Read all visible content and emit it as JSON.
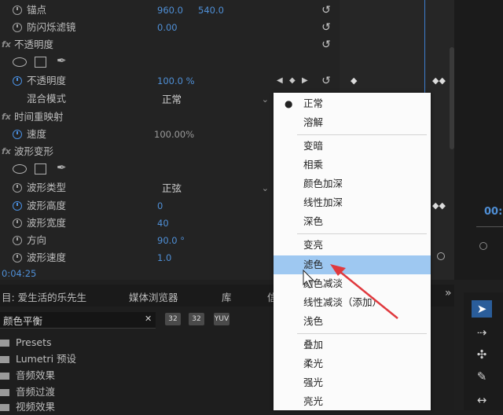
{
  "effect_controls": {
    "rows": [
      {
        "label": "锚点",
        "value": "960.0",
        "value2": "540.0"
      },
      {
        "label": "防闪烁滤镜",
        "value": "0.00"
      },
      {
        "label": "不透明度"
      },
      {
        "label": "不透明度",
        "value": "100.0 %"
      },
      {
        "label": "混合模式",
        "value": "正常"
      },
      {
        "label": "时间重映射"
      },
      {
        "label": "速度",
        "value": "100.00%"
      },
      {
        "label": "波形变形"
      },
      {
        "label": "波形类型",
        "value": "正弦"
      },
      {
        "label": "波形高度",
        "value": "0"
      },
      {
        "label": "波形宽度",
        "value": "40"
      },
      {
        "label": "方向",
        "value": "90.0 °"
      },
      {
        "label": "波形速度",
        "value": "1.0"
      }
    ],
    "fx_label": "fx",
    "timecode": "0:04:25",
    "side_timecode": "00:"
  },
  "project_panel": {
    "tabs": [
      "目: 爱生活的乐先生",
      "媒体浏览器",
      "库",
      "信"
    ],
    "more": "»",
    "search_value": "颜色平衡",
    "clear": "✕",
    "buttons": [
      "32",
      "32",
      "YUV"
    ],
    "items": [
      "Presets",
      "Lumetri 预设",
      "音频效果",
      "音频过渡",
      "视频效果"
    ]
  },
  "blend_menu": {
    "groups": [
      [
        "正常",
        "溶解"
      ],
      [
        "变暗",
        "相乘",
        "颜色加深",
        "线性加深",
        "深色"
      ],
      [
        "变亮",
        "滤色",
        "颜色减淡",
        "线性减淡（添加）",
        "浅色"
      ],
      [
        "叠加",
        "柔光",
        "强光",
        "亮光"
      ]
    ],
    "checked": "正常",
    "highlighted": "滤色"
  },
  "colors": {
    "accent": "#4f8fd6",
    "menu_highlight": "#9ec8f1",
    "arrow": "#e0393e"
  }
}
